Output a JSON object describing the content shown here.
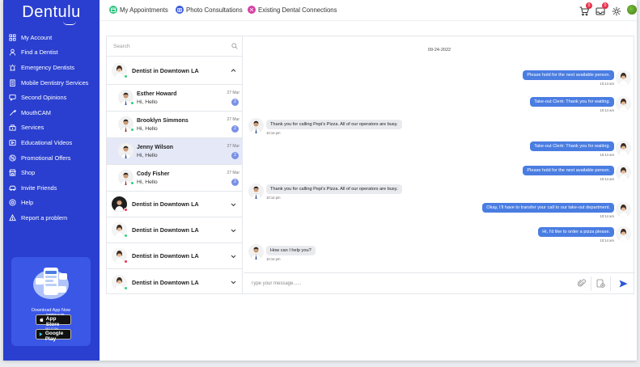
{
  "brand": {
    "name": "Dentulu"
  },
  "sidebar": {
    "items": [
      {
        "label": "My Account",
        "icon": "grid-icon"
      },
      {
        "label": "Find a Dentist",
        "icon": "person-icon"
      },
      {
        "label": "Emergency Dentists",
        "icon": "alarm-icon"
      },
      {
        "label": "Mobile Dentistry Services",
        "icon": "building-icon"
      },
      {
        "label": "Second Opinions",
        "icon": "chat-icon"
      },
      {
        "label": "MouthCAM",
        "icon": "dental-tool-icon"
      },
      {
        "label": "Services",
        "icon": "services-icon"
      },
      {
        "label": "Educational Videos",
        "icon": "video-icon"
      },
      {
        "label": "Promotional Offers",
        "icon": "offer-icon"
      },
      {
        "label": "Shop",
        "icon": "shop-icon"
      },
      {
        "label": "Invite Friends",
        "icon": "car-icon"
      },
      {
        "label": "Help",
        "icon": "help-icon"
      },
      {
        "label": "Report a problem",
        "icon": "warning-icon"
      }
    ],
    "promo": {
      "title": "Download App Now",
      "app_store_small": "Available on the",
      "app_store": "App Store",
      "google_play_small": "GET IT ON",
      "google_play": "Google Play"
    }
  },
  "topbar": {
    "tabs": [
      {
        "label": "My Appointments",
        "color": "#2ec27e"
      },
      {
        "label": "Photo Consultations",
        "color": "#3b5bdb"
      },
      {
        "label": "Existing Dental Connections",
        "color": "#d63fa3"
      }
    ],
    "cart_badge": "0",
    "inbox_badge": "0"
  },
  "chat": {
    "search_placeholder": "Search",
    "groups": [
      {
        "name": "Dentist in Downtown LA",
        "expanded": true
      },
      {
        "name": "Dentist in Downtown LA",
        "expanded": false
      },
      {
        "name": "Dentist in Downtown LA",
        "expanded": false
      },
      {
        "name": "Dentist in Downtown LA",
        "expanded": false
      },
      {
        "name": "Dentist in Downtown LA",
        "expanded": false
      }
    ],
    "contacts": [
      {
        "name": "Esther Howard",
        "message": "Hi, Hello",
        "date": "27 Mar",
        "count": "2"
      },
      {
        "name": "Brooklyn Simmons",
        "message": "Hi, Hello",
        "date": "27 Mar",
        "count": "2"
      },
      {
        "name": "Jenny Wilson",
        "message": "Hi, Hello",
        "date": "27 Mar",
        "count": "2"
      },
      {
        "name": "Cody Fisher",
        "message": "Hi, Hello",
        "date": "27 Mar",
        "count": "2"
      }
    ],
    "date_separator": "09-24-2022",
    "messages": [
      {
        "dir": "out",
        "text": "Please hold for the next available person.",
        "time": "10:14 am"
      },
      {
        "dir": "out",
        "text": "Take-out Clerk: Thank you for waiting.",
        "time": "10:14 am"
      },
      {
        "dir": "in",
        "text": "Thank you for calling Pepi's Pizza. All of our operators are busy.",
        "time": "10:14 pm"
      },
      {
        "dir": "out",
        "text": "Take-out Clerk: Thank you for waiting.",
        "time": "10:14 am"
      },
      {
        "dir": "out",
        "text": "Please hold for the next available person.",
        "time": "10:14 am"
      },
      {
        "dir": "in",
        "text": "Thank you for calling Pepi's Pizza. All of our operators are busy.",
        "time": "10:14 pm"
      },
      {
        "dir": "out",
        "text": "Okay, I'll have to transfer your call to our take-out department.",
        "time": "10:14 am"
      },
      {
        "dir": "out",
        "text": "Hi, I'd like to order a pizza please.",
        "time": "10:14 am"
      },
      {
        "dir": "in",
        "text": "How can I help you?",
        "time": "10:14 pm"
      }
    ],
    "composer_placeholder": "Type your message......"
  }
}
